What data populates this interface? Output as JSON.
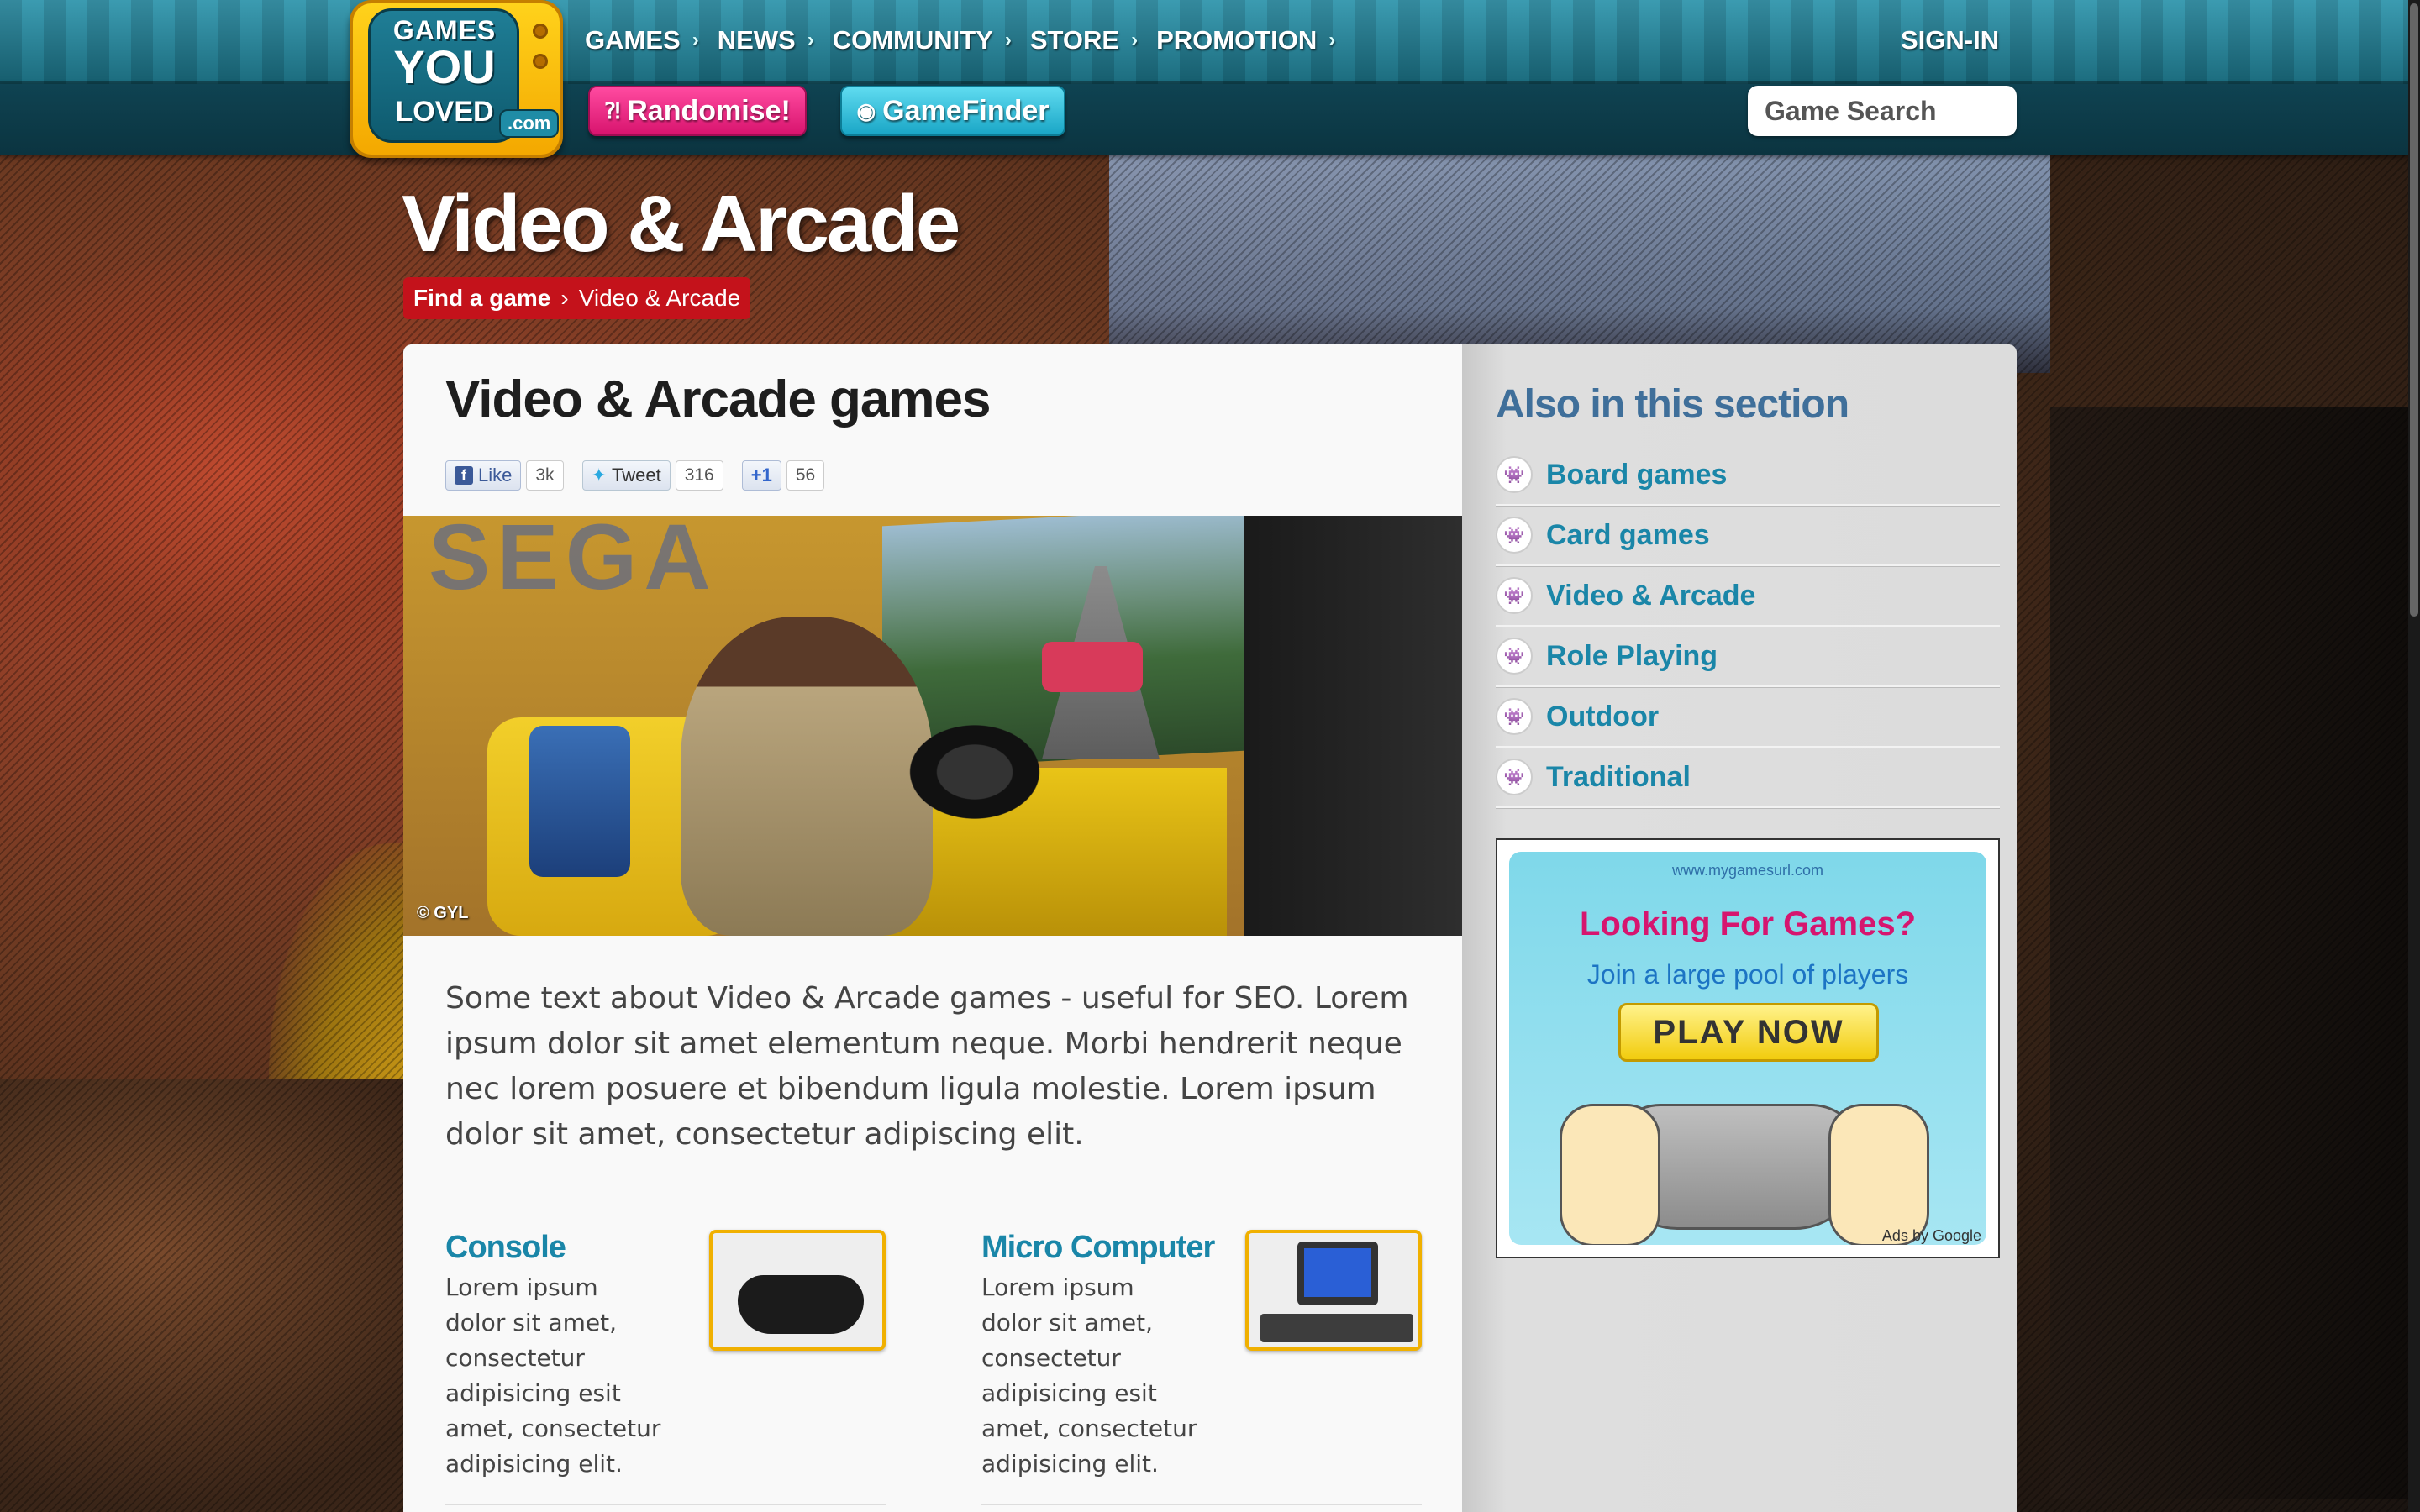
{
  "site": {
    "logo_line1": "GAMES",
    "logo_line2": "YOU",
    "logo_line3": "LOVED",
    "logo_suffix": ".com"
  },
  "nav": {
    "items": [
      {
        "label": "GAMES"
      },
      {
        "label": "NEWS"
      },
      {
        "label": "COMMUNITY"
      },
      {
        "label": "STORE"
      },
      {
        "label": "PROMOTION"
      }
    ],
    "sign_in": "SIGN-IN"
  },
  "actions": {
    "randomise_label": "Randomise!",
    "gamefinder_label": "GameFinder"
  },
  "search": {
    "placeholder": "Game Search"
  },
  "header": {
    "title": "Video & Arcade"
  },
  "breadcrumb": {
    "items": [
      "Find a game",
      "Video & Arcade"
    ]
  },
  "main": {
    "heading": "Video & Arcade games",
    "social": {
      "like_label": "Like",
      "like_count": "3k",
      "tweet_label": "Tweet",
      "tweet_count": "316",
      "plusone_label": "+1",
      "plusone_count": "56"
    },
    "hero_credit": "© GYL",
    "hero_sign": "SEGA",
    "intro": "Some text about Video & Arcade games - useful for SEO. Lorem ipsum dolor sit amet elementum neque. Morbi hendrerit neque nec lorem posuere et bibendum ligula molestie. Lorem ipsum dolor sit amet, consectetur adipiscing elit.",
    "cards": [
      {
        "title": "Console",
        "text": "Lorem ipsum dolor sit amet, consectetur adipisicing esit amet, consectetur adipisicing elit."
      },
      {
        "title": "Micro Computer",
        "text": "Lorem ipsum dolor sit amet, consectetur adipisicing esit amet, consectetur adipisicing elit."
      }
    ]
  },
  "aside": {
    "heading": "Also in this section",
    "items": [
      {
        "label": "Board games"
      },
      {
        "label": "Card games"
      },
      {
        "label": "Video & Arcade"
      },
      {
        "label": "Role Playing"
      },
      {
        "label": "Outdoor"
      },
      {
        "label": "Traditional"
      }
    ],
    "ad": {
      "url": "www.mygamesurl.com",
      "headline": "Looking For Games?",
      "subline": "Join a large pool of players",
      "cta": "PLAY NOW",
      "ads_by": "Ads by Google"
    }
  },
  "colors": {
    "accent_teal": "#1a86a8",
    "nav_bar": "#1f8399",
    "breadcrumb_red": "#c4121b",
    "thumb_border": "#f0b000"
  },
  "icons": [
    "chevron-right-icon",
    "search-icon",
    "space-invader-icon",
    "facebook-icon",
    "twitter-icon",
    "plusone-icon"
  ]
}
